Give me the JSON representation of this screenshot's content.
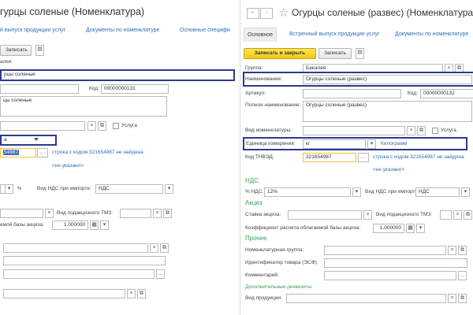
{
  "left": {
    "title": "гурцы соленые (Номенклатура)",
    "links": [
      "й выпуск продукции услуг",
      "Документы по номенклатуре",
      "Основные специфи"
    ],
    "save_label": "Записать",
    "group_label": "алея",
    "name_value": "рцы соленые",
    "fullname_value": "цы соленые",
    "code_label": "Код:",
    "code_value": "00000000131",
    "service_label": "Услуга",
    "unit_value": "а",
    "tnved_value": "54987",
    "tnved_error": "строка с кодом 321654987 не найдена",
    "not_specified": "<не указано>",
    "nds_value": "%",
    "nds_import_label": "Вид НДС при импорте:",
    "nds_import_value": "НДС",
    "excise_label": "Вид подакцизного ТМЗ:",
    "coef_label": "емой базы акциза:",
    "coef_value": "1.000000"
  },
  "right": {
    "title": "Огурцы соленые (развес) (Номенклатура)",
    "tab_main": "Основное",
    "links": [
      "Встречный выпуск продукции услуг",
      "Документы по номенклатуре",
      "Основные спе"
    ],
    "save_close_label": "Записать и закрыть",
    "save_label": "Записать",
    "group_label": "Группа:",
    "group_value": "Бакалея",
    "name_label": "Наименование:",
    "name_value": "Огурцы соленые (развес)",
    "article_label": "Артикул:",
    "code_label": "Код:",
    "code_value": "00000000132",
    "fullname_label": "Полное наименование:",
    "fullname_value": "Огурцы соленые (развес)",
    "type_label": "Вид номенклатуры:",
    "service_label": "Услуга",
    "unit_label": "Единица измерения:",
    "unit_value": "кг",
    "unit_link": "Килограмм",
    "tnved_label": "Код ТНВЭД:",
    "tnved_value": "321654987",
    "tnved_error": "строка с кодом 321654987 не найдена",
    "not_specified": "<не указано>",
    "section_nds": "НДС",
    "nds_label": "% НДС:",
    "nds_value": "12%",
    "nds_import_label": "Вид НДС при импорте:",
    "nds_import_value": "НДС",
    "section_excise": "Акциз",
    "excise_rate_label": "Ставка акциза:",
    "excise_type_label": "Вид подакцизного ТМЗ:",
    "coef_label": "Коэффициент расчета облагаемой базы акциза:",
    "coef_value": "1.000000",
    "section_other": "Прочее",
    "nom_group_label": "Номенклатурная группа:",
    "esf_label": "Идентификатор товара (ЭСФ):",
    "comment_label": "Комментарий:",
    "section_extra": "Дополнительные реквизиты",
    "product_type_label": "Вид продукции:"
  }
}
